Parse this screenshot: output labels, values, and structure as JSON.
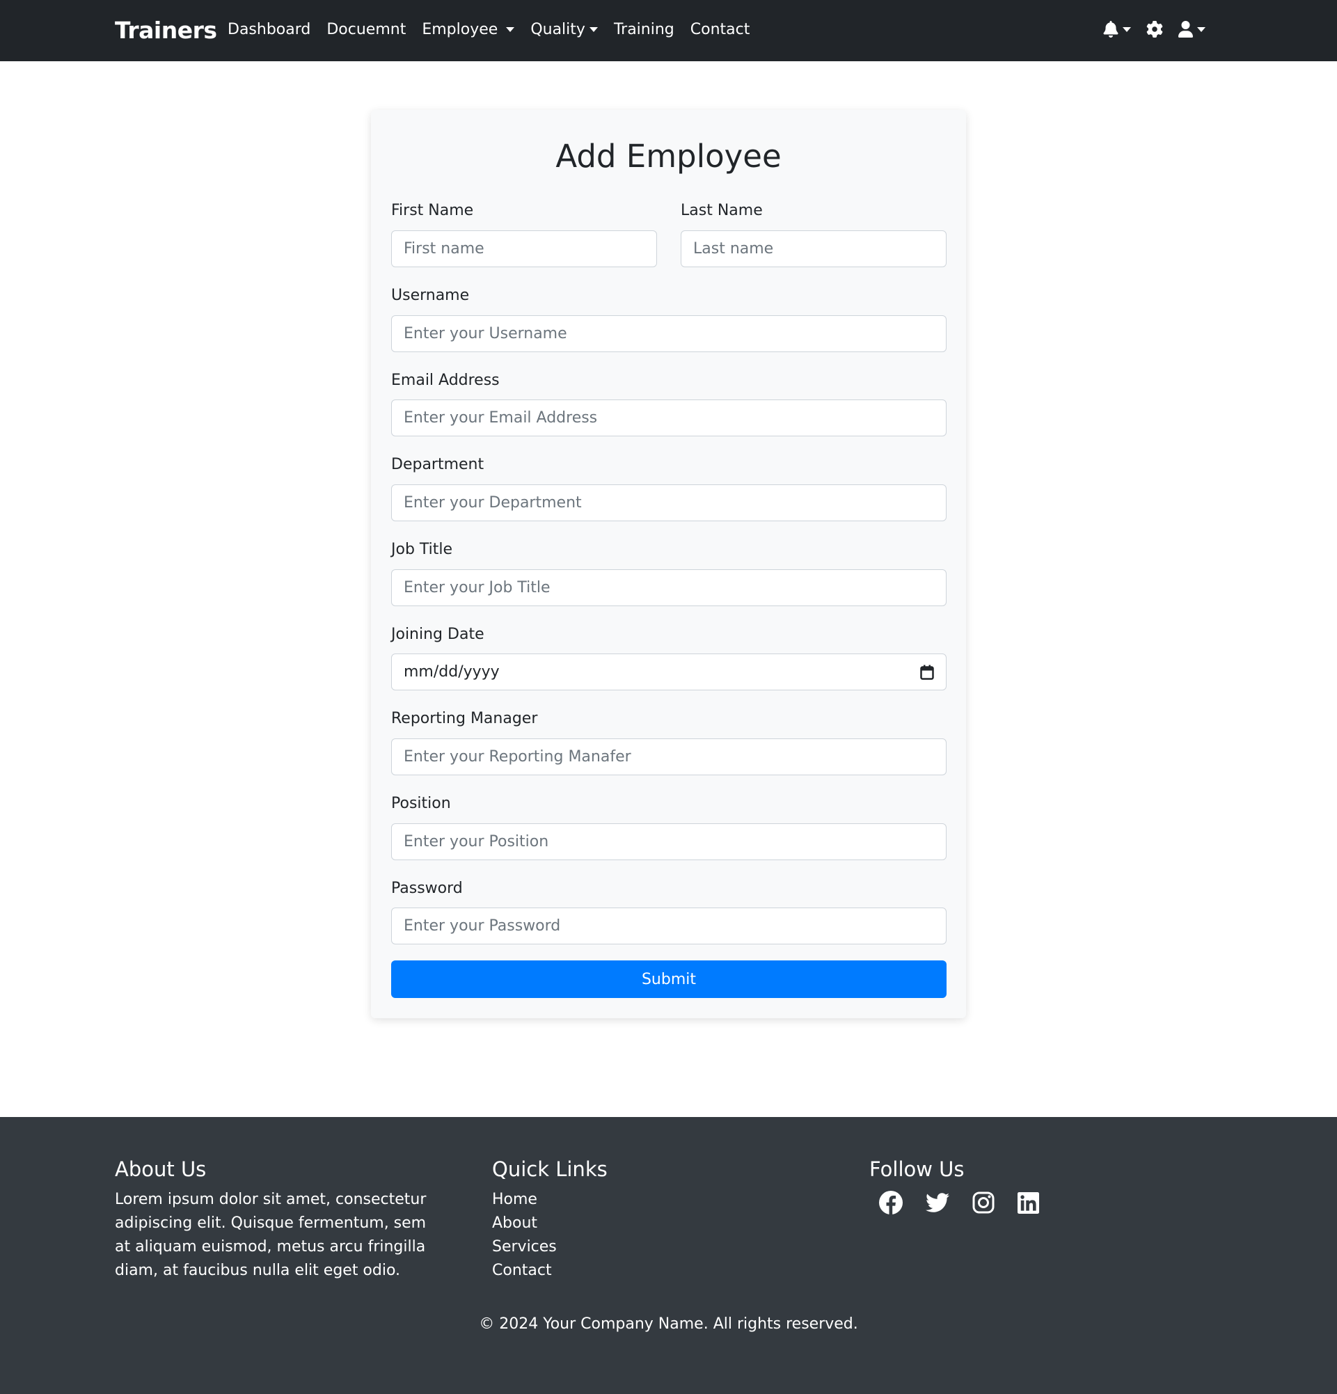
{
  "navbar": {
    "brand": "Trainers",
    "links": {
      "dashboard": "Dashboard",
      "document": "Docuemnt",
      "employee": "Employee",
      "quality": "Quality",
      "training": "Training",
      "contact": "Contact"
    },
    "icons": [
      "bell-icon",
      "gear-icon",
      "user-icon"
    ]
  },
  "form": {
    "title": "Add Employee",
    "first_name": {
      "label": "First Name",
      "placeholder": "First name",
      "value": ""
    },
    "last_name": {
      "label": "Last Name",
      "placeholder": "Last name",
      "value": ""
    },
    "username": {
      "label": "Username",
      "placeholder": "Enter your Username",
      "value": ""
    },
    "email": {
      "label": "Email Address",
      "placeholder": "Enter your Email Address",
      "value": ""
    },
    "department": {
      "label": "Department",
      "placeholder": "Enter your Department",
      "value": ""
    },
    "job_title": {
      "label": "Job Title",
      "placeholder": "Enter your Job Title",
      "value": ""
    },
    "joining_date": {
      "label": "Joining Date",
      "placeholder": "mm/dd/yyyy",
      "value": ""
    },
    "reporting_manager": {
      "label": "Reporting Manager",
      "placeholder": "Enter your Reporting Manafer",
      "value": ""
    },
    "position": {
      "label": "Position",
      "placeholder": "Enter your Position",
      "value": ""
    },
    "password": {
      "label": "Password",
      "placeholder": "Enter your Password",
      "value": ""
    },
    "submit_label": "Submit"
  },
  "footer": {
    "about": {
      "heading": "About Us",
      "text": "Lorem ipsum dolor sit amet, consectetur adipiscing elit. Quisque fermentum, sem at aliquam euismod, metus arcu fringilla diam, at faucibus nulla elit eget odio."
    },
    "quick_links": {
      "heading": "Quick Links",
      "items": [
        "Home",
        "About",
        "Services",
        "Contact"
      ]
    },
    "follow": {
      "heading": "Follow Us",
      "icons": [
        "facebook-icon",
        "twitter-icon",
        "instagram-icon",
        "linkedin-icon"
      ]
    },
    "copyright": "© 2024 Your Company Name. All rights reserved."
  },
  "colors": {
    "navbar_bg": "#212529",
    "card_bg": "#f8f9fa",
    "primary": "#007bff",
    "footer_bg": "#343a40"
  }
}
